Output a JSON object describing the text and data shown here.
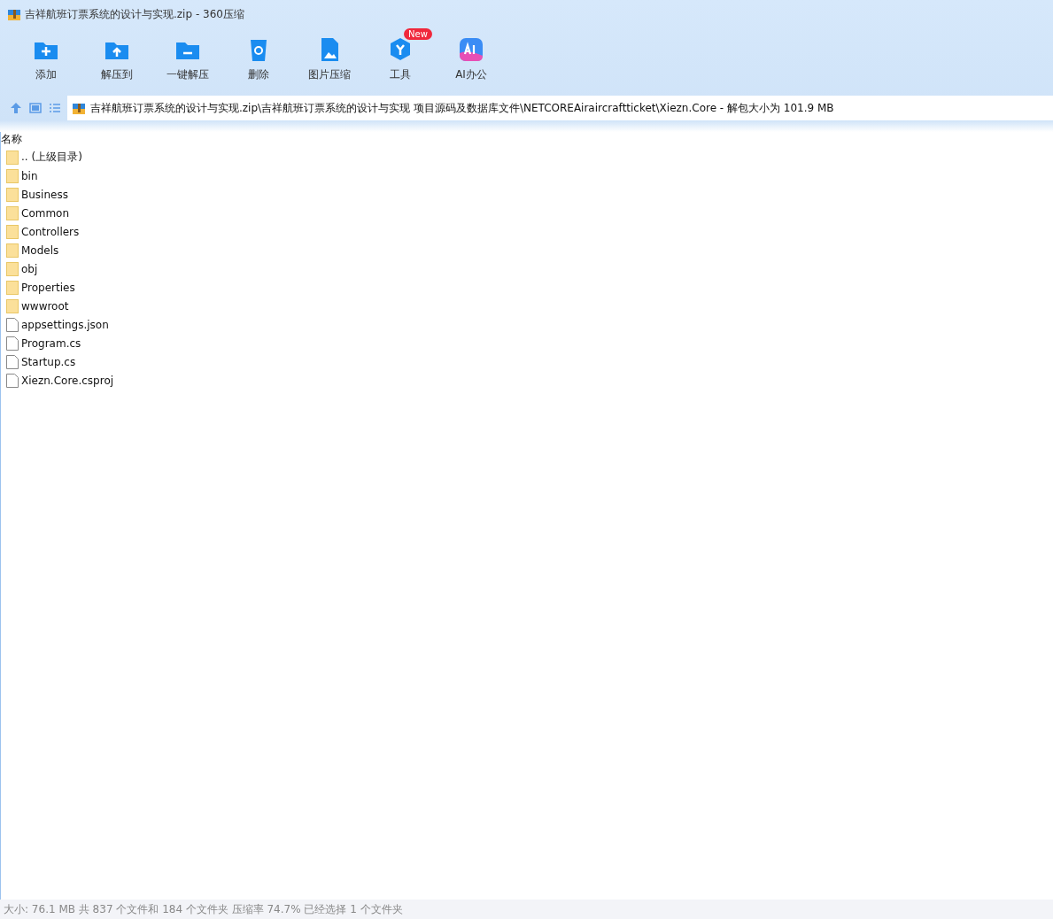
{
  "window": {
    "title": "吉祥航班订票系统的设计与实现.zip - 360压缩"
  },
  "toolbar": [
    {
      "kind": "add",
      "label": "添加"
    },
    {
      "kind": "extract",
      "label": "解压到"
    },
    {
      "kind": "onekey",
      "label": "一键解压"
    },
    {
      "kind": "delete",
      "label": "删除"
    },
    {
      "kind": "image",
      "label": "图片压缩"
    },
    {
      "kind": "tools",
      "label": "工具",
      "badge": "New"
    },
    {
      "kind": "ai",
      "label": "AI办公"
    }
  ],
  "address": {
    "path": "吉祥航班订票系统的设计与实现.zip\\吉祥航班订票系统的设计与实现 项目源码及数据库文件\\NETCOREAiraircraftticket\\Xiezn.Core - 解包大小为 101.9 MB"
  },
  "table": {
    "columns": [
      "名称"
    ],
    "rows": [
      {
        "kind": "folder",
        "name": ".. (上级目录)"
      },
      {
        "kind": "folder",
        "name": "bin"
      },
      {
        "kind": "folder",
        "name": "Business"
      },
      {
        "kind": "folder",
        "name": "Common"
      },
      {
        "kind": "folder",
        "name": "Controllers"
      },
      {
        "kind": "folder",
        "name": "Models"
      },
      {
        "kind": "folder",
        "name": "obj"
      },
      {
        "kind": "folder",
        "name": "Properties"
      },
      {
        "kind": "folder",
        "name": "wwwroot"
      },
      {
        "kind": "file",
        "name": "appsettings.json"
      },
      {
        "kind": "file",
        "name": "Program.cs"
      },
      {
        "kind": "file",
        "name": "Startup.cs"
      },
      {
        "kind": "file",
        "name": "Xiezn.Core.csproj"
      }
    ]
  },
  "status_bar": "大小: 76.1 MB 共 837 个文件和 184 个文件夹 压缩率 74.7% 已经选择 1 个文件夹"
}
